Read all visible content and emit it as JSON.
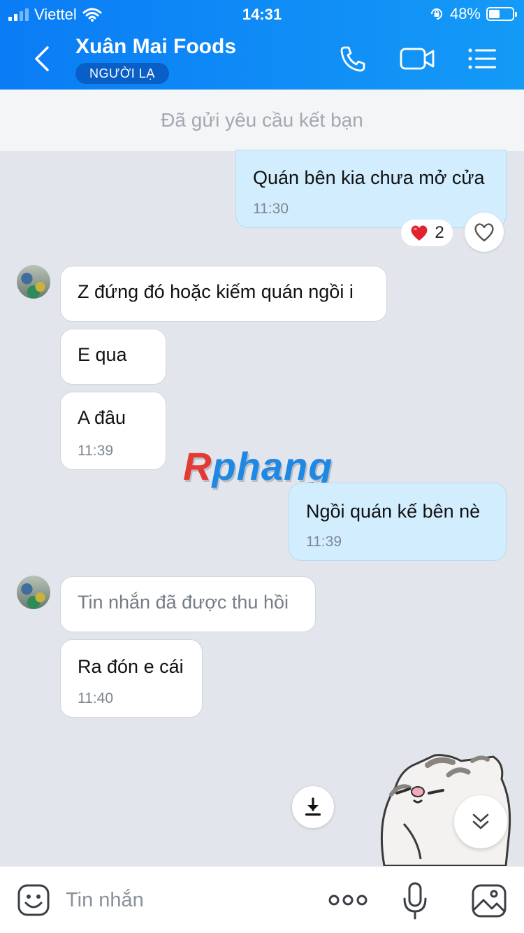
{
  "status_bar": {
    "carrier": "Viettel",
    "time": "14:31",
    "battery": "48%"
  },
  "header": {
    "title": "Xuân Mai Foods",
    "badge": "NGƯỜI LẠ"
  },
  "friend_request": {
    "text": "Đã gửi yêu cầu kết bạn"
  },
  "messages": [
    {
      "from": "me",
      "text": "Quán bên kia chưa mở cửa",
      "time": "11:30",
      "reaction_count": "2"
    },
    {
      "from": "them",
      "text": "Z đứng đó hoặc kiếm quán ngồi i"
    },
    {
      "from": "them",
      "text": "E qua"
    },
    {
      "from": "them",
      "text": "A đâu",
      "time": "11:39"
    },
    {
      "from": "me",
      "text": "Ngồi quán kế bên nè",
      "time": "11:39"
    },
    {
      "from": "them",
      "text": "Tin nhắn đã được thu hồi",
      "recalled": true
    },
    {
      "from": "them",
      "text": "Ra đón e cái",
      "time": "11:40"
    }
  ],
  "watermark": {
    "first": "R",
    "rest": "phang"
  },
  "composer": {
    "placeholder": "Tin nhắn"
  },
  "colors": {
    "header": "#0a7cf5",
    "outgoing_bubble": "#d2eefe",
    "incoming_bubble": "#ffffff",
    "background": "#e2e6ec"
  }
}
